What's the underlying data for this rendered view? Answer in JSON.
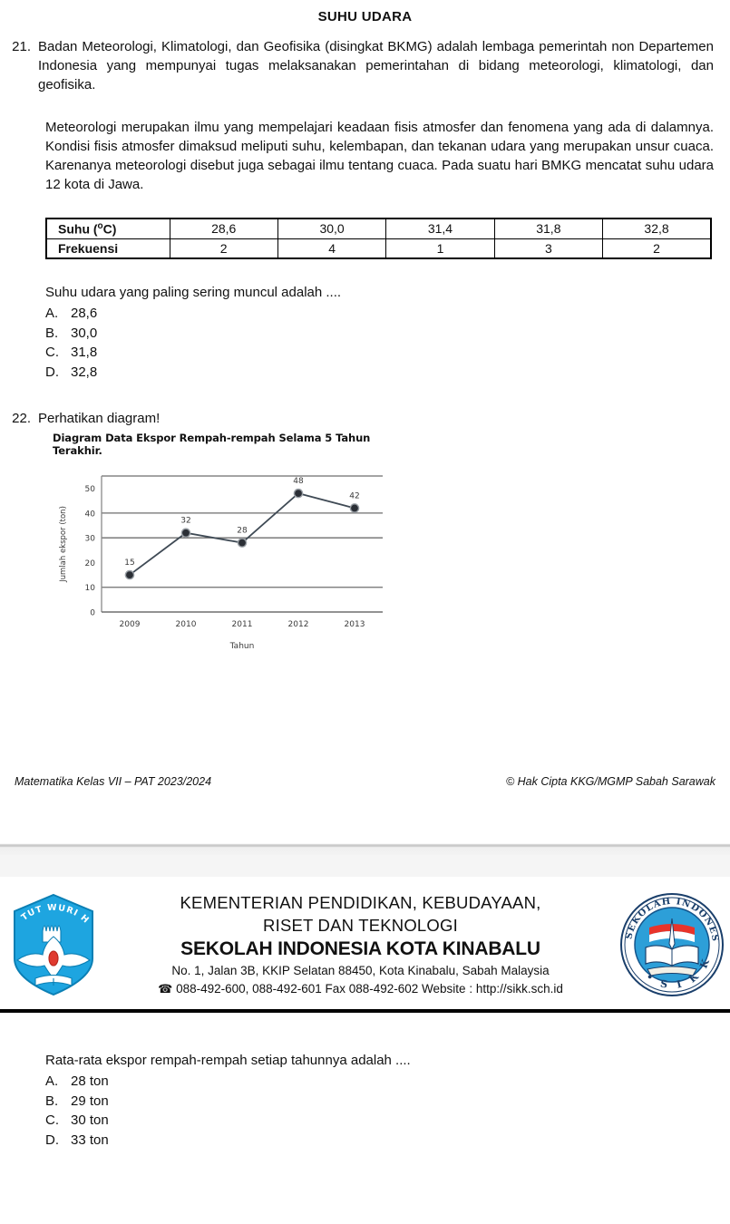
{
  "page1": {
    "doc_title": "SUHU UDARA",
    "q21": {
      "number": "21.",
      "paragraph1": "Badan Meteorologi, Klimatologi, dan Geofisika (disingkat BKMG) adalah lembaga pemerintah non Departemen Indonesia yang mempunyai tugas melaksanakan pemerintahan di bidang meteorologi, klimatologi, dan geofisika.",
      "paragraph2": "Meteorologi merupakan ilmu yang mempelajari keadaan fisis atmosfer dan fenomena yang ada di dalamnya. Kondisi fisis atmosfer dimaksud meliputi suhu, kelembapan, dan tekanan udara yang merupakan unsur cuaca. Karenanya meteorologi disebut juga sebagai ilmu tentang cuaca. Pada suatu hari BMKG mencatat suhu udara 12 kota di Jawa.",
      "table": {
        "row1_header": "Suhu (",
        "row1_sup": "o",
        "row1_header_tail": "C)",
        "row2_header": "Frekuensi",
        "suhu": [
          "28,6",
          "30,0",
          "31,4",
          "31,8",
          "32,8"
        ],
        "frekuensi": [
          "2",
          "4",
          "1",
          "3",
          "2"
        ]
      },
      "stem": "Suhu udara yang paling sering muncul adalah ....",
      "options": [
        {
          "label": "A.",
          "text": "28,6"
        },
        {
          "label": "B.",
          "text": "30,0"
        },
        {
          "label": "C.",
          "text": "31,8"
        },
        {
          "label": "D.",
          "text": "32,8"
        }
      ]
    },
    "q22": {
      "number": "22.",
      "stem": "Perhatikan diagram!"
    },
    "footer": {
      "left": "Matematika Kelas VII – PAT 2023/2024",
      "right": "© Hak Cipta KKG/MGMP Sabah Sarawak"
    }
  },
  "chart_data": {
    "type": "line",
    "title": "Diagram Data Ekspor Rempah-rempah Selama 5 Tahun Terakhir.",
    "xlabel": "Tahun",
    "ylabel": "Jumlah ekspor (ton)",
    "categories": [
      "2009",
      "2010",
      "2011",
      "2012",
      "2013"
    ],
    "values": [
      15,
      32,
      28,
      48,
      42
    ],
    "data_labels": [
      "15",
      "32",
      "28",
      "48",
      "42"
    ],
    "yticks": [
      "0",
      "10",
      "20",
      "30",
      "40",
      "50"
    ],
    "ytick_values": [
      0,
      10,
      20,
      30,
      40,
      50
    ],
    "ylim": [
      0,
      55
    ],
    "gridlines_at": [
      10,
      30,
      40,
      55
    ],
    "grid": true,
    "legend": "none",
    "line_color": "#3f4a55",
    "marker_color": "#2b2f36"
  },
  "page2": {
    "letterhead": {
      "line1": "KEMENTERIAN PENDIDIKAN, KEBUDAYAAN,",
      "line2": "RISET DAN TEKNOLOGI",
      "line3": "SEKOLAH INDONESIA KOTA KINABALU",
      "line4": "No. 1, Jalan 3B, KKIP Selatan 88450, Kota Kinabalu, Sabah Malaysia",
      "phone_icon": "☎",
      "line5": "088-492-600, 088-492-601 Fax 088-492-602 Website : http://sikk.sch.id",
      "left_logo": {
        "name": "tut-wuri-handayani-logo",
        "motto": "TUT WURI HANDAYANI",
        "color": "#1ea5e0"
      },
      "right_logo": {
        "name": "sikk-school-logo",
        "ring_text": "SEKOLAH INDONESIA KOTA KINABALU",
        "abbr": "SIKK",
        "color": "#1a6fb0"
      }
    },
    "q22b": {
      "stem": "Rata-rata ekspor rempah-rempah setiap tahunnya adalah ....",
      "options": [
        {
          "label": "A.",
          "text": "28 ton"
        },
        {
          "label": "B.",
          "text": "29 ton"
        },
        {
          "label": "C.",
          "text": "30 ton"
        },
        {
          "label": "D.",
          "text": "33 ton"
        }
      ]
    }
  }
}
